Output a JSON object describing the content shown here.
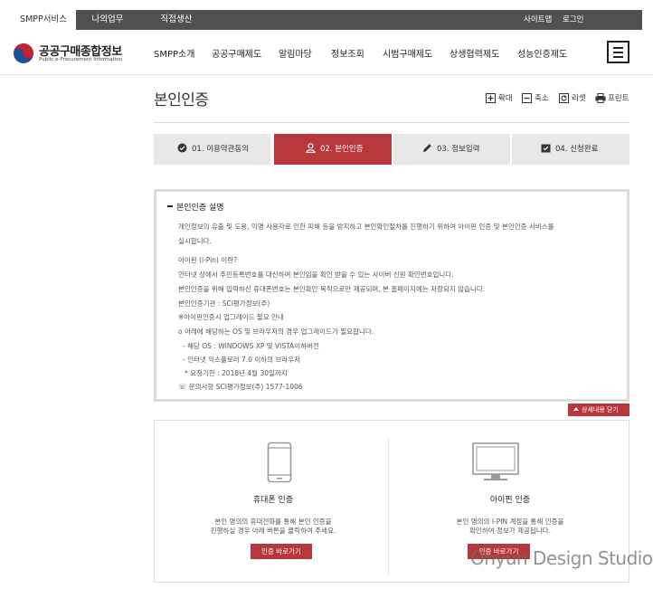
{
  "topbar": {
    "tabs": [
      {
        "label": "SMPP서비스",
        "active": true
      },
      {
        "label": "나의업무",
        "active": false
      },
      {
        "label": "직접생산",
        "active": false
      }
    ],
    "utility": [
      "사이트맵",
      "로그인"
    ]
  },
  "logo": {
    "name": "공공구매종합정보",
    "subtitle": "Public e-Procurement Information"
  },
  "nav": {
    "items": [
      "SMPP소개",
      "공공구매제도",
      "알림마당",
      "정보조회",
      "시범구매제도",
      "상생협력제도",
      "성능인증제도"
    ],
    "menu_icon": "hamburger-icon"
  },
  "page": {
    "title": "본인인증",
    "tools": [
      {
        "label": "확대",
        "icon": "zoom-in-icon"
      },
      {
        "label": "축소",
        "icon": "zoom-out-icon"
      },
      {
        "label": "리셋",
        "icon": "reset-icon"
      },
      {
        "label": "프린트",
        "icon": "print-icon"
      }
    ]
  },
  "steps": [
    {
      "label": "01. 이용약관동의",
      "icon": "check-circle-icon",
      "active": false
    },
    {
      "label": "02. 본인인증",
      "icon": "user-icon",
      "active": true
    },
    {
      "label": "03. 정보입력",
      "icon": "pencil-icon",
      "active": false
    },
    {
      "label": "04. 신청완료",
      "icon": "check-box-icon",
      "active": false
    }
  ],
  "info": {
    "title": "본인인증 설명",
    "lines": [
      "개인정보의 유출 및 도용, 익명 사용자로 인한 피해 등을 방지하고 본인확인절차를 진행하기 위하여 아이핀 인증 및 본인인증 서비스를",
      "실시합니다.",
      "아이핀 (i-Pin) 이란?",
      "인터넷 상에서 주민등록번호를 대신하여 본인임을 확인 받을 수 있는 사이버 신원 확인번호입니다.",
      "본인인증을 위해 입력하신 휴대폰번호는 본인확인 목적으로만 제공되며, 본 홈페이지에는 저장되지 않습니다.",
      "본인인증기관 : SCI평가정보(주)",
      "※아이핀인증시 업그레이드 필요 안내",
      "o 아래에 해당하는 OS 및 브라우저의 경우 업그레이드가 필요합니다.",
      "- 해당 OS : WINDOWS XP 및 VISTA이하버전",
      "- 인터넷 익스플로러 7.0 이하의 브라우저",
      "* 요청기한 : 2018년 4월 30일까지",
      "☏ 문의사항 SCI평가정보(주) 1577-1006"
    ],
    "close_label": "상세내용 닫기"
  },
  "auth": {
    "phone": {
      "title": "휴대폰 인증",
      "desc1": "본인 명의의 휴대전화를 통해 본인 인증을",
      "desc2": "진행하실 경우 아래 버튼을 클릭하여 주세요.",
      "button": "인증 바로가기",
      "icon": "mobile-phone-icon"
    },
    "ipin": {
      "title": "아이핀 인증",
      "desc1": "본인 명의의 I-PIN 계정을 통해 인증을",
      "desc2": "확인하여 정보가 제공됩니다.",
      "button": "인증 바로가기",
      "icon": "monitor-icon"
    }
  },
  "watermark": "Onyun Design Studio",
  "colors": {
    "accent": "#b7373a",
    "topbar": "#505050",
    "step_bg": "#e8e8e8"
  }
}
